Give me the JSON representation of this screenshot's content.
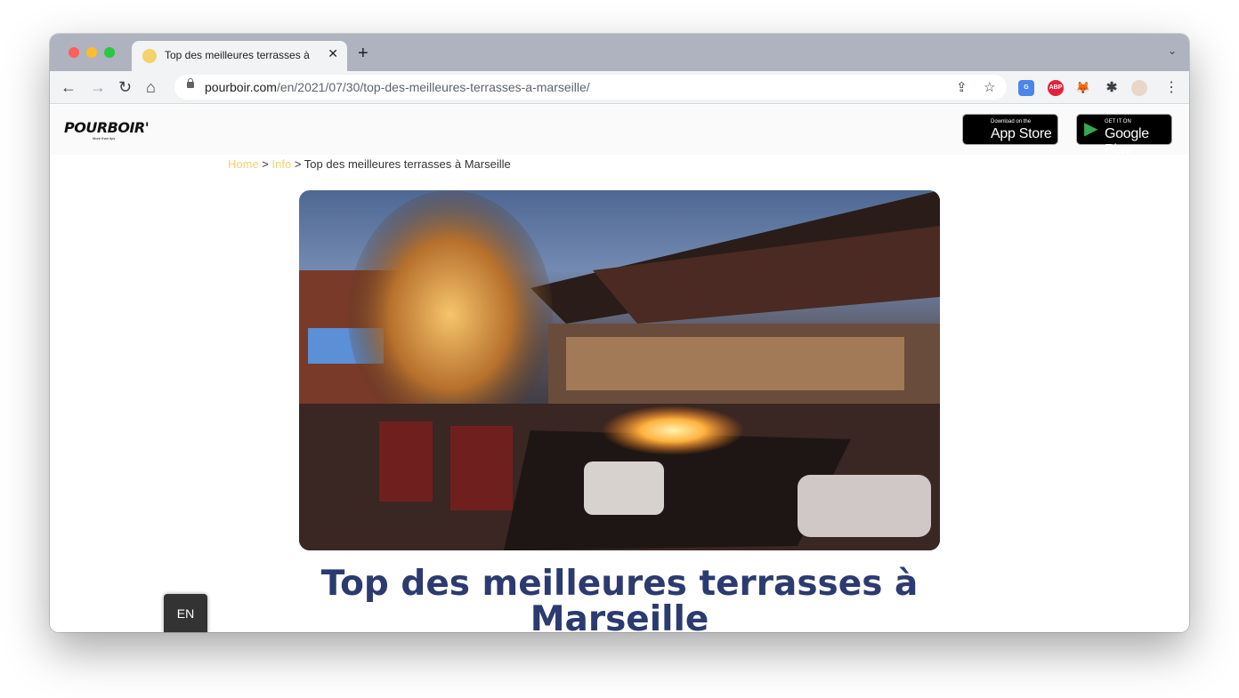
{
  "browser": {
    "tab": {
      "title": "Top des meilleures terrasses à",
      "close_glyph": "✕"
    },
    "new_tab_glyph": "+",
    "tab_dropdown_glyph": "⌄",
    "nav": {
      "back": "←",
      "forward": "→",
      "reload": "↻",
      "home": "⌂"
    },
    "url": {
      "host": "pourboir.com",
      "path": "/en/2021/07/30/top-des-meilleures-terrasses-a-marseille/"
    },
    "omnibox_icons": {
      "share": "⇪",
      "bookmark": "☆"
    },
    "extensions": [
      {
        "name": "translate-extension-icon",
        "label": "G",
        "color": "#4a86e8"
      },
      {
        "name": "adblock-extension-icon",
        "label": "ABP",
        "color": "#e5203b"
      },
      {
        "name": "metamask-extension-icon",
        "label": "🦊",
        "color": "#f1f3f4"
      },
      {
        "name": "puzzle-extension-icon",
        "label": "✱",
        "color": "#f1f3f4"
      }
    ],
    "menu_glyph": "⋮"
  },
  "site": {
    "logo": "POURBOIR'",
    "logo_tagline": "More than tips",
    "app_store": {
      "small": "Download on the",
      "big": "App Store"
    },
    "google_play": {
      "small": "GET IT ON",
      "big": "Google Play"
    }
  },
  "breadcrumb": {
    "home": "Home",
    "sep1": " > ",
    "info": "Info",
    "sep2": " > ",
    "current": "Top des meilleures terrasses à Marseille"
  },
  "article": {
    "hero_alt": "Outdoor restaurant terrace with string lights and fire table at dusk",
    "title": "Top des meilleures terrasses à Marseille"
  },
  "language_switcher": "EN",
  "colors": {
    "title": "#2c3b6f",
    "breadcrumb_link": "#f4d26a",
    "tab_strip": "#aeb3bf"
  }
}
